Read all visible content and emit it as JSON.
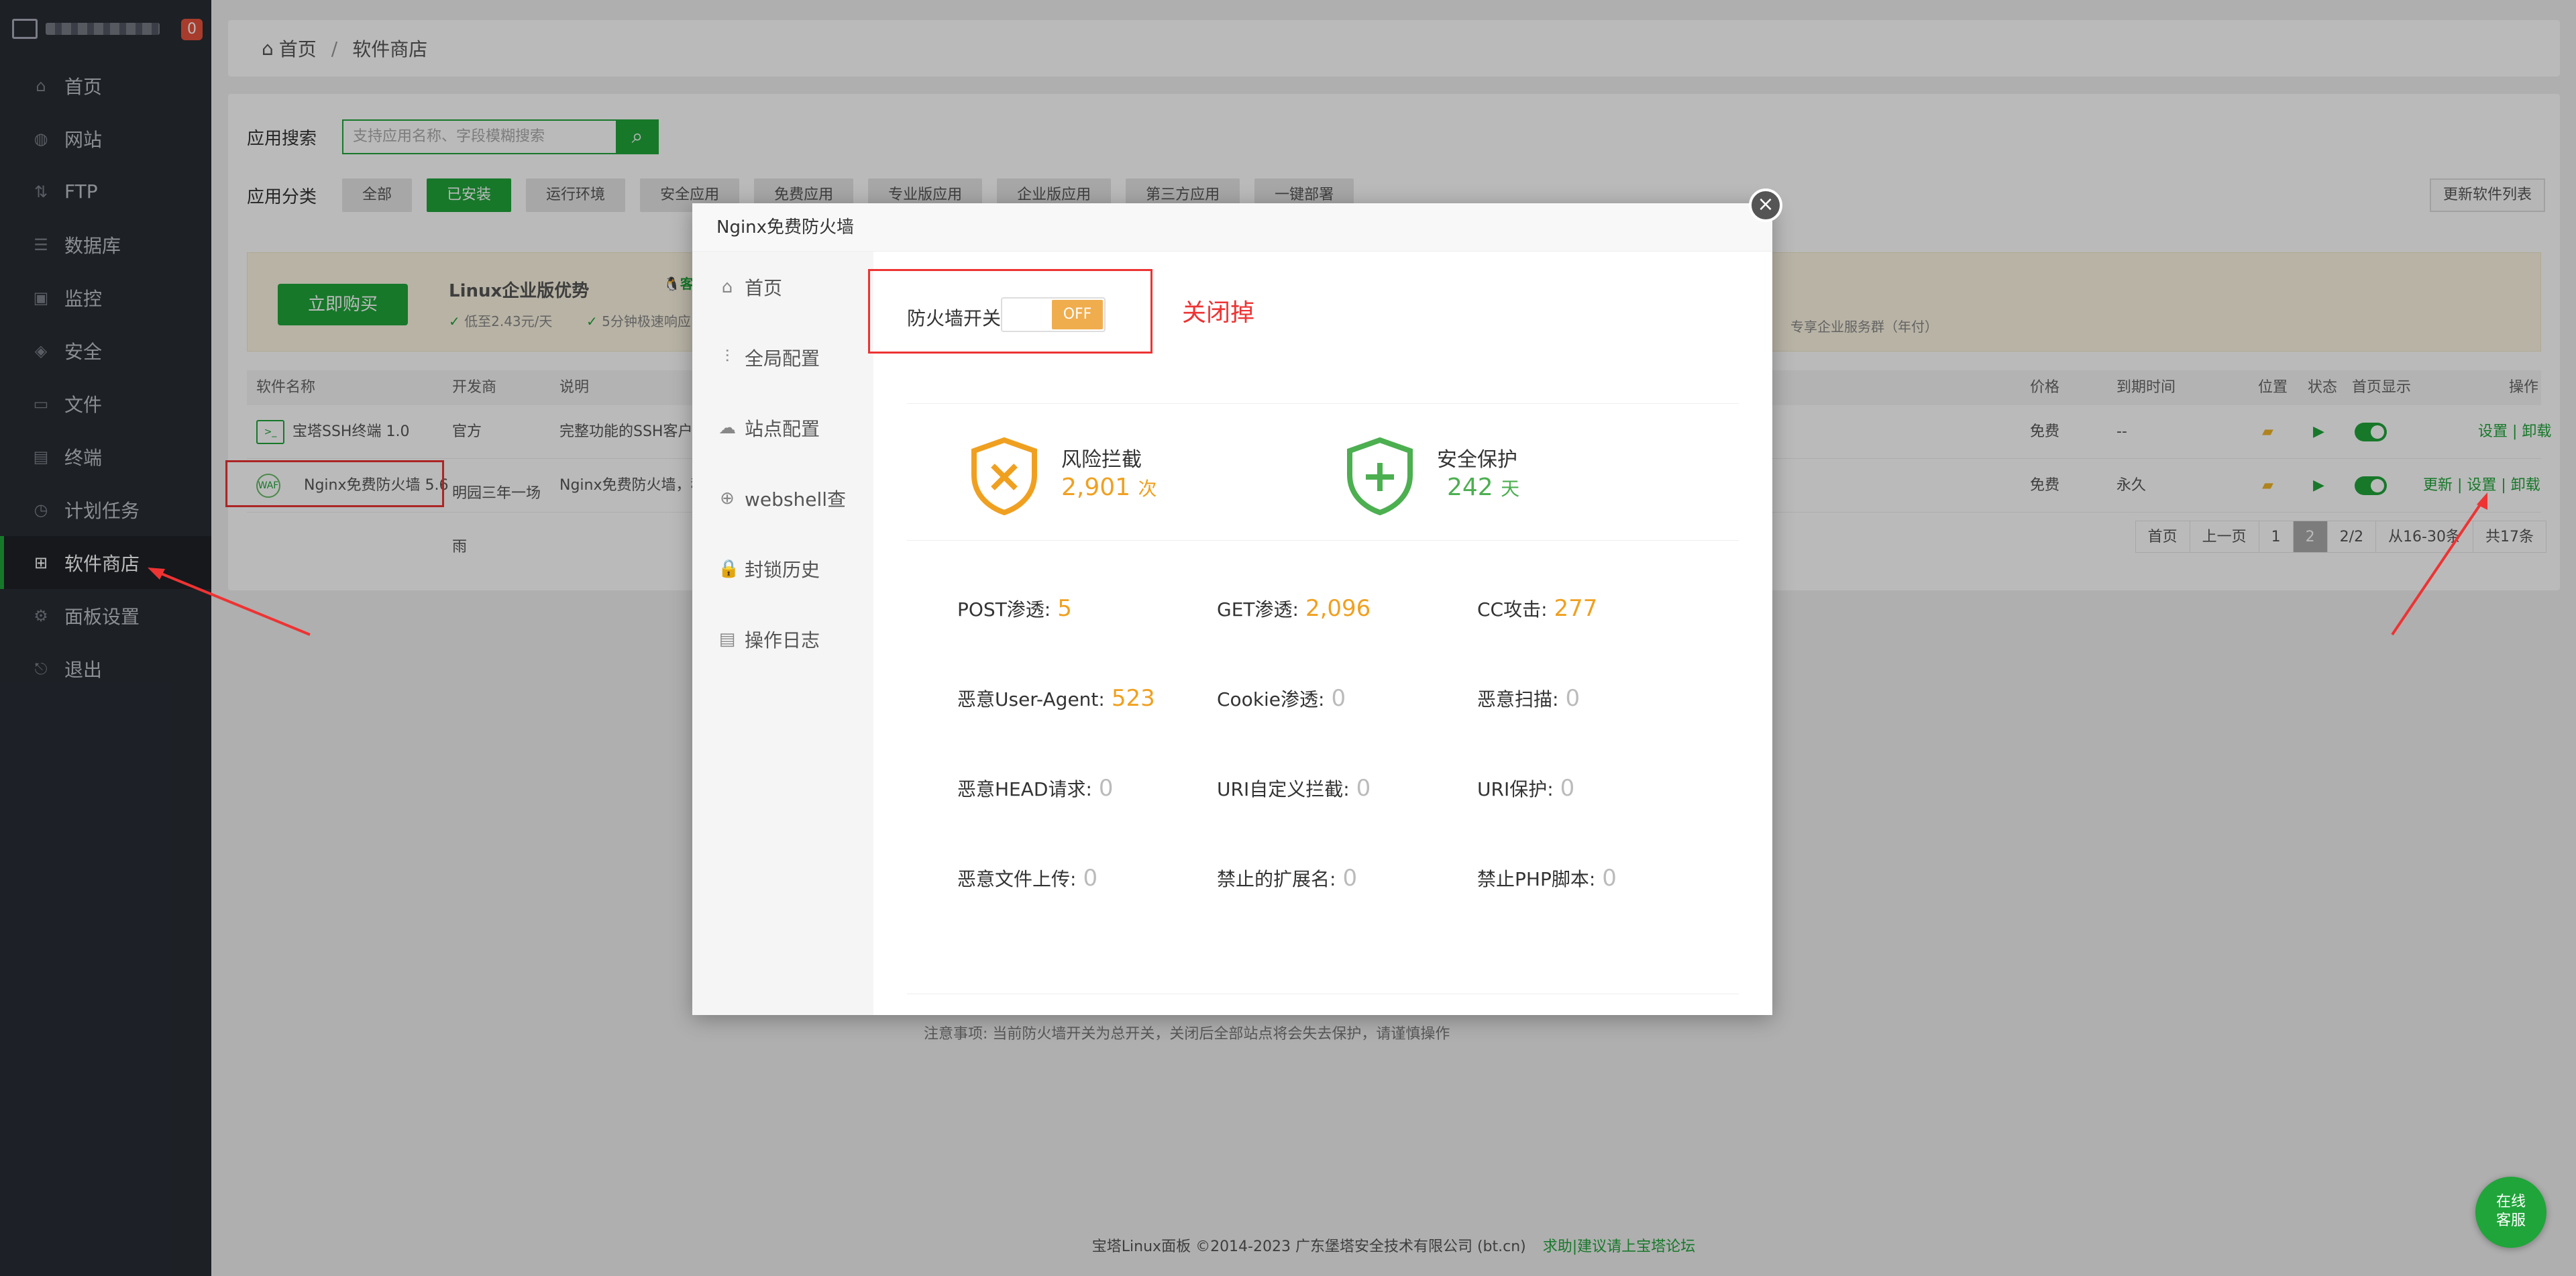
{
  "sidebar": {
    "badge": "0",
    "items": [
      {
        "label": "首页",
        "icon": "home-icon"
      },
      {
        "label": "网站",
        "icon": "globe-icon"
      },
      {
        "label": "FTP",
        "icon": "ftp-icon"
      },
      {
        "label": "数据库",
        "icon": "database-icon"
      },
      {
        "label": "监控",
        "icon": "monitor-icon"
      },
      {
        "label": "安全",
        "icon": "shield-icon"
      },
      {
        "label": "文件",
        "icon": "folder-icon"
      },
      {
        "label": "终端",
        "icon": "terminal-icon"
      },
      {
        "label": "计划任务",
        "icon": "clock-icon"
      },
      {
        "label": "软件商店",
        "icon": "grid-icon"
      },
      {
        "label": "面板设置",
        "icon": "gear-icon"
      },
      {
        "label": "退出",
        "icon": "logout-icon"
      }
    ]
  },
  "breadcrumb": {
    "home": "首页",
    "sep": "/",
    "current": "软件商店"
  },
  "search": {
    "label": "应用搜索",
    "placeholder": "支持应用名称、字段模糊搜索"
  },
  "category": {
    "label": "应用分类",
    "items": [
      "全部",
      "已安装",
      "运行环境",
      "安全应用",
      "免费应用",
      "专业版应用",
      "企业版应用",
      "第三方应用",
      "一键部署"
    ],
    "update": "更新软件列表"
  },
  "promo": {
    "buy": "立即购买",
    "title": "Linux企业版优势",
    "qq": "客服",
    "sub1": "低至2.43元/天",
    "sub2": "5分钟极速响应",
    "right": "专享企业服务群（年付）"
  },
  "table": {
    "headers": [
      "软件名称",
      "开发商",
      "说明",
      "价格",
      "到期时间",
      "位置",
      "状态",
      "首页显示",
      "操作"
    ],
    "rows": [
      {
        "name": "宝塔SSH终端 1.0",
        "dev": "官方",
        "desc": "完整功能的SSH客户端",
        "price": "免费",
        "expire": "--",
        "ops": "设置 | 卸载"
      },
      {
        "name": "Nginx免费防火墙 5.6",
        "dev1": "明园三年一场",
        "dev2": "雨",
        "desc": "Nginx免费防火墙，稍",
        "price": "免费",
        "expire": "永久",
        "ops": "更新 | 设置 | 卸载"
      }
    ]
  },
  "pager": [
    "首页",
    "上一页",
    "1",
    "2",
    "2/2",
    "从16-30条",
    "共17条"
  ],
  "footer": {
    "text": "宝塔Linux面板 ©2014-2023 广东堡塔安全技术有限公司 (bt.cn)",
    "link": "求助|建议请上宝塔论坛"
  },
  "modal": {
    "title": "Nginx免费防火墙",
    "close": "×",
    "nav": [
      {
        "label": "首页",
        "icon": "home-icon"
      },
      {
        "label": "全局配置",
        "icon": "sliders-icon"
      },
      {
        "label": "站点配置",
        "icon": "cloud-icon"
      },
      {
        "label": "webshell查",
        "icon": "crosshair-icon"
      },
      {
        "label": "封锁历史",
        "icon": "lock-icon"
      },
      {
        "label": "操作日志",
        "icon": "clipboard-icon"
      }
    ],
    "switch_label": "防火墙开关",
    "switch_state": "OFF",
    "annotation": "关闭掉",
    "stats": [
      {
        "title": "风险拦截",
        "value": "2,901",
        "unit": "次",
        "color": "#f0a020"
      },
      {
        "title": "安全保护",
        "value": "242",
        "unit": "天",
        "color": "#4caf50"
      }
    ],
    "metrics": [
      {
        "label": "POST渗透:",
        "value": "5"
      },
      {
        "label": "GET渗透:",
        "value": "2,096"
      },
      {
        "label": "CC攻击:",
        "value": "277"
      },
      {
        "label": "恶意User-Agent:",
        "value": "523"
      },
      {
        "label": "Cookie渗透:",
        "value": "0"
      },
      {
        "label": "恶意扫描:",
        "value": "0"
      },
      {
        "label": "恶意HEAD请求:",
        "value": "0"
      },
      {
        "label": "URI自定义拦截:",
        "value": "0"
      },
      {
        "label": "URI保护:",
        "value": "0"
      },
      {
        "label": "恶意文件上传:",
        "value": "0"
      },
      {
        "label": "禁止的扩展名:",
        "value": "0"
      },
      {
        "label": "禁止PHP脚本:",
        "value": "0"
      }
    ],
    "note": "注意事项: 当前防火墙开关为总开关，关闭后全部站点将会失去保护，请谨慎操作"
  },
  "chat": {
    "line1": "在线",
    "line2": "客服"
  }
}
